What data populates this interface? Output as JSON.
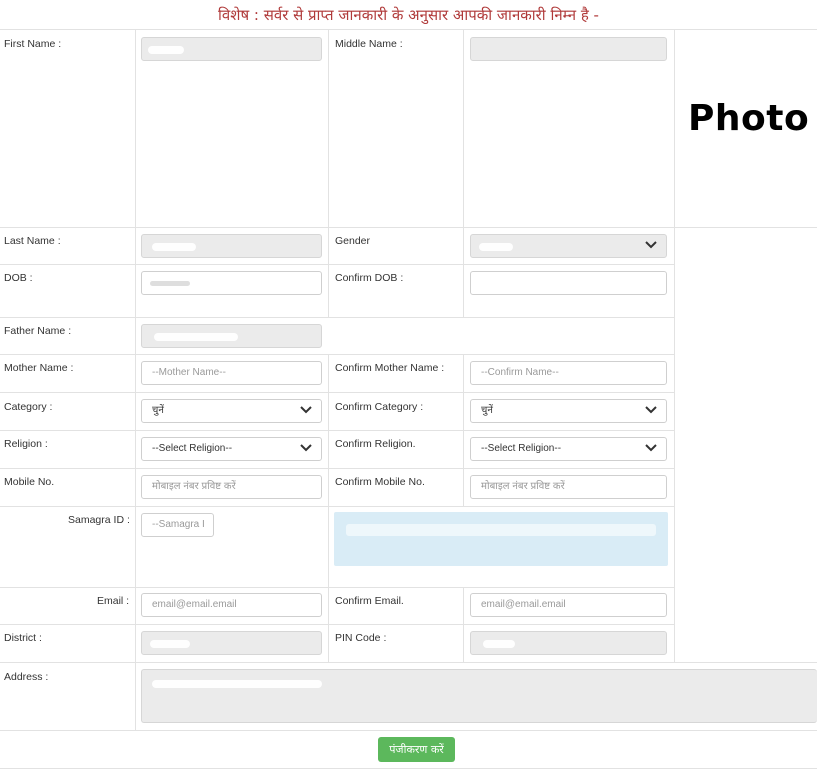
{
  "notice": "विशेष : सर्वर से प्राप्त जानकारी के अनुसार आपकी जानकारी निम्न है -",
  "photo_label": "Photo",
  "labels": {
    "first_name": "First Name :",
    "middle_name": "Middle Name :",
    "last_name": "Last Name :",
    "gender": "Gender",
    "dob": "DOB :",
    "confirm_dob": "Confirm DOB :",
    "father_name": "Father Name :",
    "mother_name": "Mother Name :",
    "confirm_mother_name": "Confirm Mother Name :",
    "category": "Category :",
    "confirm_category": "Confirm Category :",
    "religion": "Religion :",
    "confirm_religion": "Confirm Religion.",
    "mobile": "Mobile No.",
    "confirm_mobile": "Confirm Mobile No.",
    "samagra": "Samagra ID :",
    "email": "Email :",
    "confirm_email": "Confirm Email.",
    "district": "District :",
    "pin": "PIN Code :",
    "address": "Address :"
  },
  "placeholders": {
    "mother_name": "--Mother Name--",
    "confirm_mother_name": "--Confirm Name--",
    "mobile": "मोबाइल नंबर प्रविष्ट करें",
    "confirm_mobile": "मोबाइल नंबर प्रविष्ट करें",
    "samagra": "--Samagra I",
    "email": "email@email.email",
    "confirm_email": "email@email.email"
  },
  "selects": {
    "category": "चुनें",
    "confirm_category": "चुनें",
    "religion": "--Select Religion--",
    "confirm_religion": "--Select Religion--"
  },
  "submit_label": "पंजीकरण करें"
}
